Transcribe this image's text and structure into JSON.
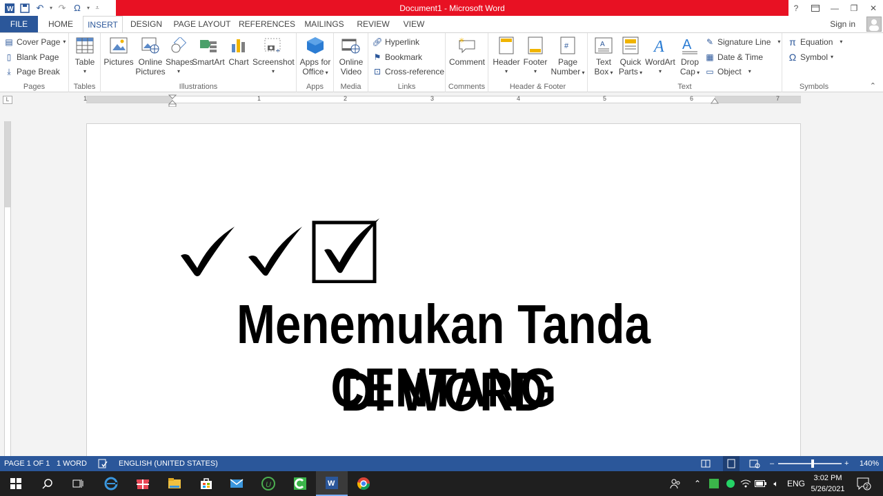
{
  "window": {
    "title": "Document1 -  Microsoft Word",
    "help": "?",
    "controls": [
      "?",
      "⧉",
      "—",
      "❐",
      "✕"
    ]
  },
  "tabs": {
    "file": "FILE",
    "home": "HOME",
    "insert": "INSERT",
    "design": "DESIGN",
    "page_layout": "PAGE LAYOUT",
    "references": "REFERENCES",
    "mailings": "MAILINGS",
    "review": "REVIEW",
    "view": "VIEW",
    "sign_in": "Sign in"
  },
  "ribbon": {
    "pages": {
      "label": "Pages",
      "cover_page": "Cover Page",
      "blank_page": "Blank Page",
      "page_break": "Page Break"
    },
    "tables": {
      "label": "Tables",
      "table": "Table"
    },
    "illustrations": {
      "label": "Illustrations",
      "pictures": "Pictures",
      "online_pictures_1": "Online",
      "online_pictures_2": "Pictures",
      "shapes": "Shapes",
      "smartart": "SmartArt",
      "chart": "Chart",
      "screenshot": "Screenshot"
    },
    "apps": {
      "label": "Apps",
      "apps_1": "Apps for",
      "apps_2": "Office"
    },
    "media": {
      "label": "Media",
      "video_1": "Online",
      "video_2": "Video"
    },
    "links": {
      "label": "Links",
      "hyperlink": "Hyperlink",
      "bookmark": "Bookmark",
      "cross_reference": "Cross-reference"
    },
    "comments": {
      "label": "Comments",
      "comment": "Comment"
    },
    "header_footer": {
      "label": "Header & Footer",
      "header": "Header",
      "footer": "Footer",
      "page_number_1": "Page",
      "page_number_2": "Number"
    },
    "text": {
      "label": "Text",
      "textbox_1": "Text",
      "textbox_2": "Box",
      "quickparts_1": "Quick",
      "quickparts_2": "Parts",
      "wordart": "WordArt",
      "dropcap_1": "Drop",
      "dropcap_2": "Cap",
      "signature_line": "Signature Line",
      "date_time": "Date & Time",
      "object": "Object"
    },
    "symbols": {
      "label": "Symbols",
      "equation": "Equation",
      "symbol": "Symbol"
    }
  },
  "ruler": {
    "ticks": [
      "1",
      "1",
      "2",
      "3",
      "4",
      "5",
      "6",
      "7"
    ],
    "corner": "L"
  },
  "document": {
    "checks": [
      "✔",
      "✓",
      "☑"
    ],
    "line1": "Menemukan Tanda CENTANG",
    "line2": "DI WORD"
  },
  "status": {
    "page": "PAGE 1 OF 1",
    "words": "1 WORD",
    "language": "ENGLISH (UNITED STATES)",
    "zoom": "140%",
    "zoom_minus": "–",
    "zoom_plus": "+"
  },
  "taskbar": {
    "language": "ENG",
    "time": "3:02 PM",
    "date": "5/26/2021",
    "notifications": "2"
  },
  "colors": {
    "word_blue": "#2b579a",
    "title_red": "#e81123",
    "taskbar": "#1f1f1f"
  }
}
